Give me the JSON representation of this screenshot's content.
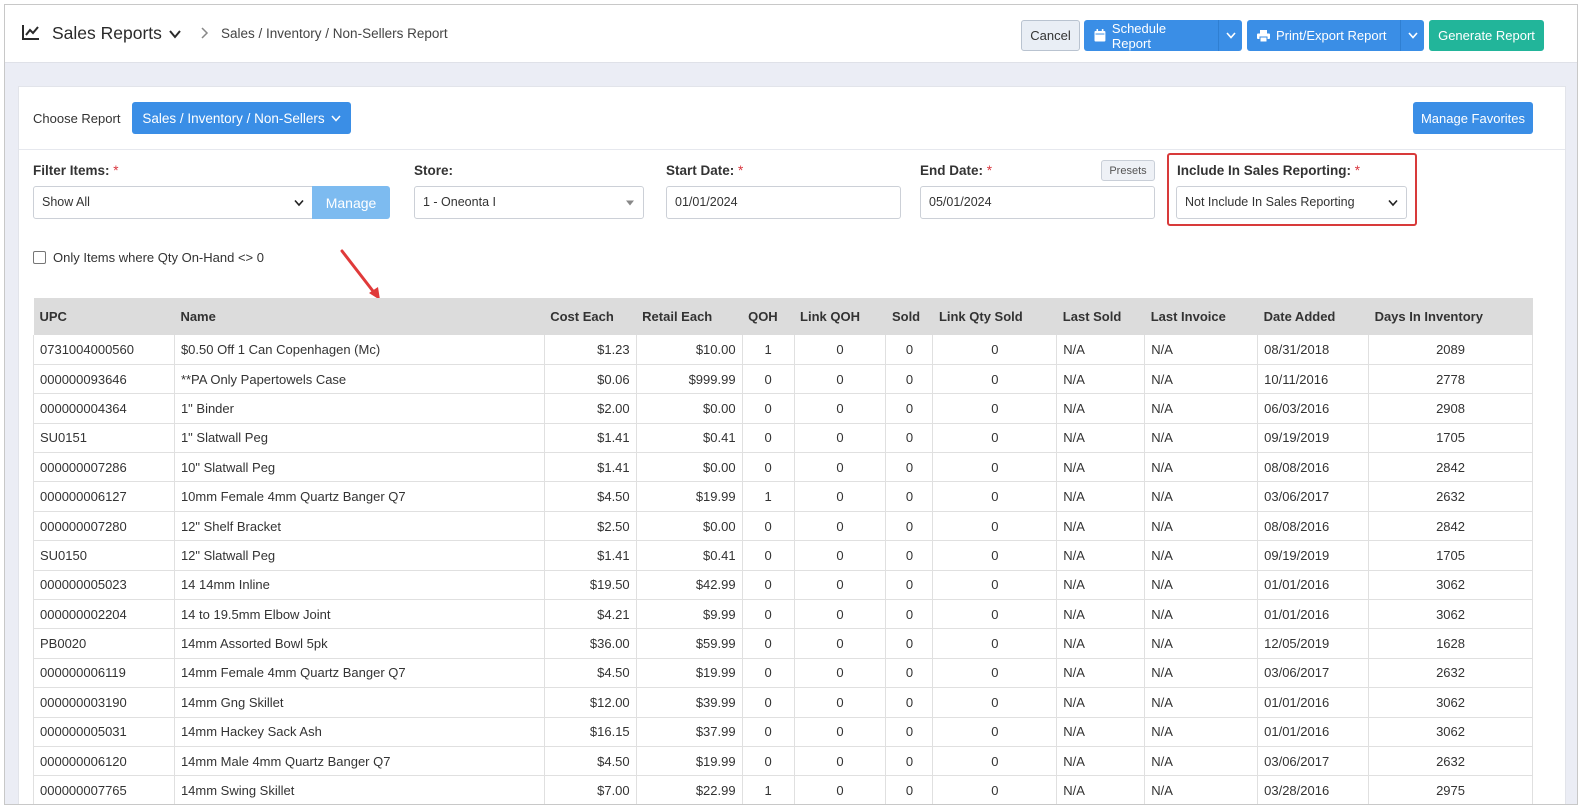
{
  "header": {
    "title": "Sales Reports",
    "breadcrumb": "Sales / Inventory / Non-Sellers Report",
    "cancel_label": "Cancel",
    "schedule_label": "Schedule Report",
    "print_label": "Print/Export Report",
    "generate_label": "Generate Report",
    "icons": [
      "chart-line-icon",
      "chevron-down-icon",
      "chevron-right-icon",
      "calendar-icon",
      "printer-icon"
    ]
  },
  "report_picker": {
    "label": "Choose Report",
    "selected": "Sales / Inventory / Non-Sellers",
    "favorites_label": "Manage Favorites"
  },
  "filters": {
    "filter_items": {
      "label": "Filter Items:",
      "value": "Show All",
      "manage_label": "Manage"
    },
    "store": {
      "label": "Store:",
      "value": "1 - Oneonta I"
    },
    "start_date": {
      "label": "Start Date:",
      "value": "01/01/2024"
    },
    "end_date": {
      "label": "End Date:",
      "value": "05/01/2024",
      "presets_label": "Presets"
    },
    "include_sales": {
      "label": "Include In Sales Reporting:",
      "value": "Not Include In Sales Reporting"
    },
    "required_mark": "*",
    "qty_checkbox_label": "Only Items where Qty On-Hand <> 0",
    "qty_checkbox_checked": false
  },
  "colors": {
    "primary": "#3a8ee6",
    "success": "#22b59a",
    "highlight": "#d83a3a"
  },
  "table": {
    "columns": [
      "UPC",
      "Name",
      "Cost Each",
      "Retail Each",
      "QOH",
      "Link QOH",
      "Sold",
      "Link Qty Sold",
      "Last Sold",
      "Last Invoice",
      "Date Added",
      "Days In Inventory"
    ],
    "rows": [
      [
        "0731004000560",
        "$0.50 Off 1 Can Copenhagen (Mc)",
        "$1.23",
        "$10.00",
        "1",
        "0",
        "0",
        "0",
        "N/A",
        "N/A",
        "08/31/2018",
        "2089"
      ],
      [
        "000000093646",
        "**PA Only Papertowels Case",
        "$0.06",
        "$999.99",
        "0",
        "0",
        "0",
        "0",
        "N/A",
        "N/A",
        "10/11/2016",
        "2778"
      ],
      [
        "000000004364",
        "1\" Binder",
        "$2.00",
        "$0.00",
        "0",
        "0",
        "0",
        "0",
        "N/A",
        "N/A",
        "06/03/2016",
        "2908"
      ],
      [
        "SU0151",
        "1\" Slatwall Peg",
        "$1.41",
        "$0.41",
        "0",
        "0",
        "0",
        "0",
        "N/A",
        "N/A",
        "09/19/2019",
        "1705"
      ],
      [
        "000000007286",
        "10\" Slatwall Peg",
        "$1.41",
        "$0.00",
        "0",
        "0",
        "0",
        "0",
        "N/A",
        "N/A",
        "08/08/2016",
        "2842"
      ],
      [
        "000000006127",
        "10mm Female 4mm Quartz Banger Q7",
        "$4.50",
        "$19.99",
        "1",
        "0",
        "0",
        "0",
        "N/A",
        "N/A",
        "03/06/2017",
        "2632"
      ],
      [
        "000000007280",
        "12\" Shelf Bracket",
        "$2.50",
        "$0.00",
        "0",
        "0",
        "0",
        "0",
        "N/A",
        "N/A",
        "08/08/2016",
        "2842"
      ],
      [
        "SU0150",
        "12\" Slatwall Peg",
        "$1.41",
        "$0.41",
        "0",
        "0",
        "0",
        "0",
        "N/A",
        "N/A",
        "09/19/2019",
        "1705"
      ],
      [
        "000000005023",
        "14 14mm Inline",
        "$19.50",
        "$42.99",
        "0",
        "0",
        "0",
        "0",
        "N/A",
        "N/A",
        "01/01/2016",
        "3062"
      ],
      [
        "000000002204",
        "14 to 19.5mm Elbow Joint",
        "$4.21",
        "$9.99",
        "0",
        "0",
        "0",
        "0",
        "N/A",
        "N/A",
        "01/01/2016",
        "3062"
      ],
      [
        "PB0020",
        "14mm Assorted Bowl 5pk",
        "$36.00",
        "$59.99",
        "0",
        "0",
        "0",
        "0",
        "N/A",
        "N/A",
        "12/05/2019",
        "1628"
      ],
      [
        "000000006119",
        "14mm Female 4mm Quartz Banger Q7",
        "$4.50",
        "$19.99",
        "0",
        "0",
        "0",
        "0",
        "N/A",
        "N/A",
        "03/06/2017",
        "2632"
      ],
      [
        "000000003190",
        "14mm Gng Skillet",
        "$12.00",
        "$39.99",
        "0",
        "0",
        "0",
        "0",
        "N/A",
        "N/A",
        "01/01/2016",
        "3062"
      ],
      [
        "000000005031",
        "14mm Hackey Sack Ash",
        "$16.15",
        "$37.99",
        "0",
        "0",
        "0",
        "0",
        "N/A",
        "N/A",
        "01/01/2016",
        "3062"
      ],
      [
        "000000006120",
        "14mm Male 4mm Quartz Banger Q7",
        "$4.50",
        "$19.99",
        "0",
        "0",
        "0",
        "0",
        "N/A",
        "N/A",
        "03/06/2017",
        "2632"
      ],
      [
        "000000007765",
        "14mm Swing Skillet",
        "$7.00",
        "$22.99",
        "1",
        "0",
        "0",
        "0",
        "N/A",
        "N/A",
        "03/28/2016",
        "2975"
      ]
    ]
  }
}
